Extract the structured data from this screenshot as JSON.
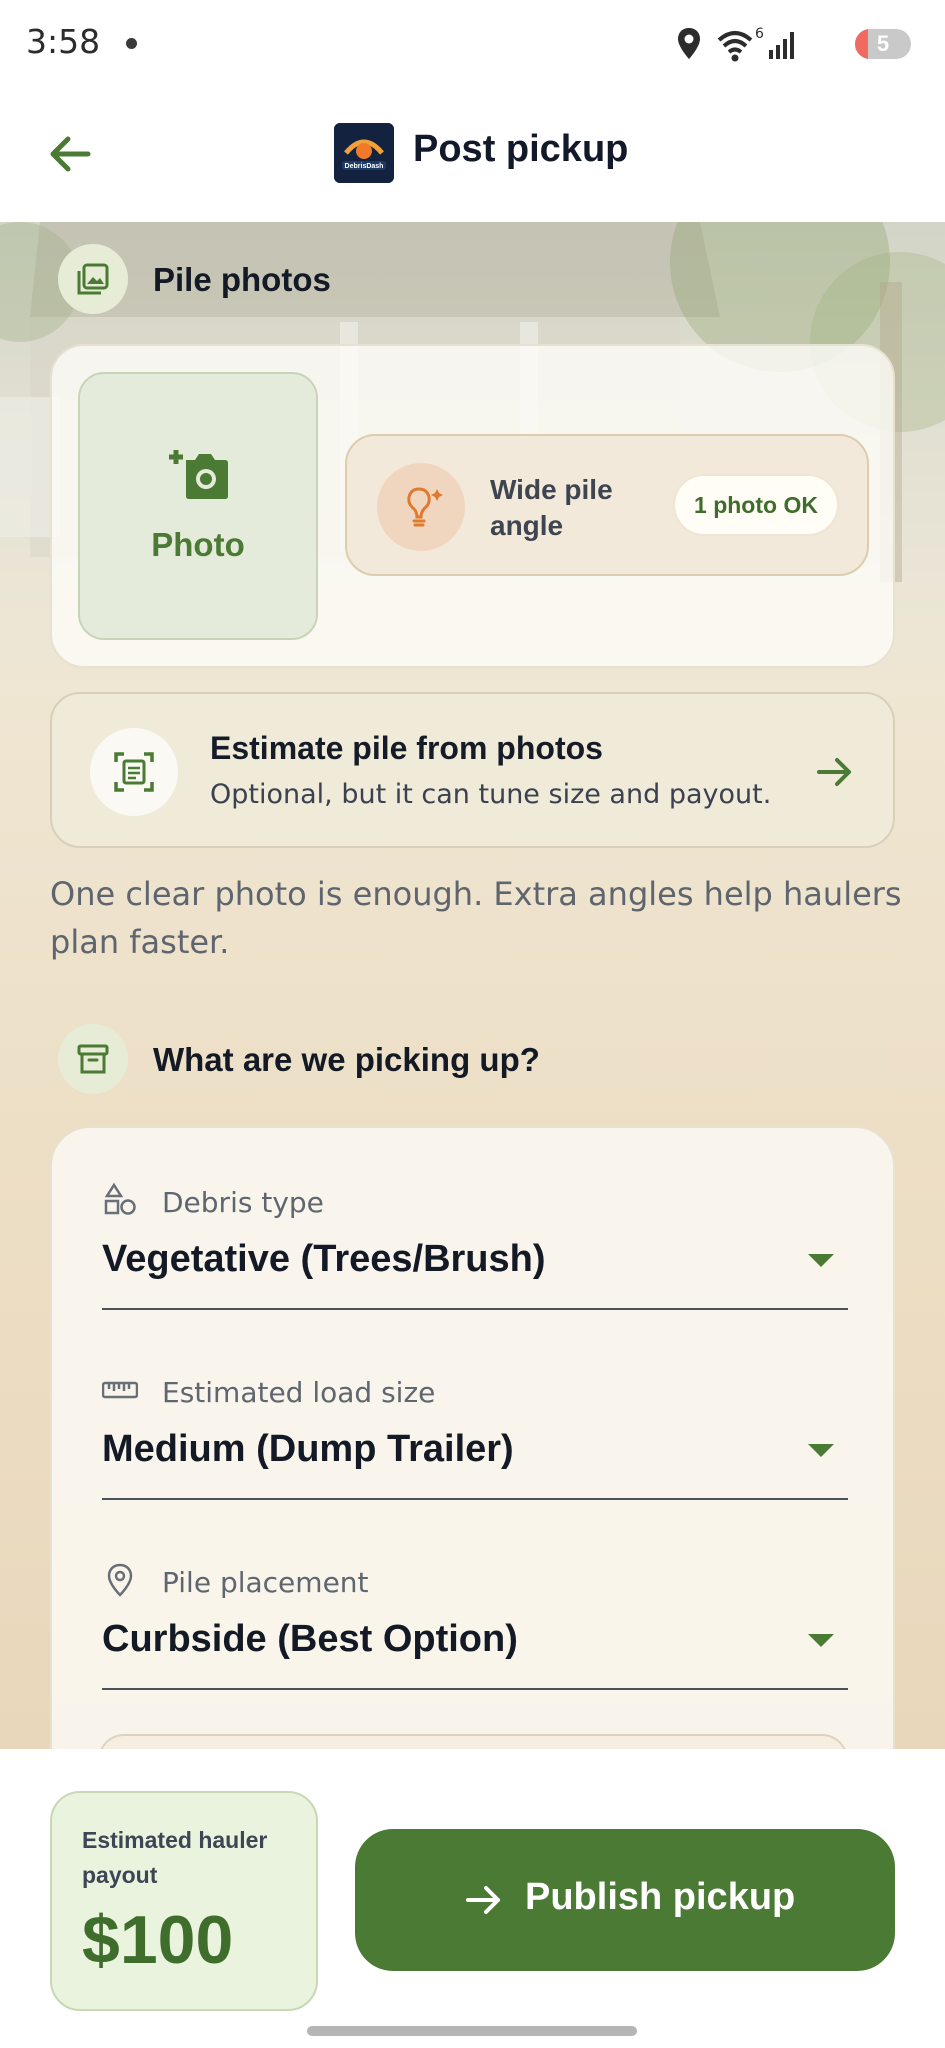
{
  "status_bar": {
    "time": "3:58",
    "battery": "5",
    "icons": [
      "location-icon",
      "wifi-icon",
      "cell-signal-icon",
      "battery-icon"
    ],
    "wifi_badge": "6"
  },
  "app_bar": {
    "title": "Post pickup",
    "logo_text": "DebrisDash"
  },
  "photos_section": {
    "title": "Pile photos",
    "photo_button_label": "Photo",
    "tip_text": "Wide pile angle",
    "tip_badge": "1 photo OK"
  },
  "estimate_card": {
    "title": "Estimate pile from photos",
    "subtitle": "Optional, but it can tune size and payout."
  },
  "helper_text": "One clear photo is enough. Extra angles help haulers plan faster.",
  "details_section": {
    "title": "What are we picking up?",
    "fields": [
      {
        "label": "Debris type",
        "value": "Vegetative (Trees/Brush)",
        "icon": "shapes-icon"
      },
      {
        "label": "Estimated load size",
        "value": "Medium (Dump Trailer)",
        "icon": "ruler-icon"
      },
      {
        "label": "Pile placement",
        "value": "Curbside (Best Option)",
        "icon": "location-pin-icon"
      }
    ]
  },
  "bottom_bar": {
    "payout_label": "Estimated hauler payout",
    "payout_value": "$100",
    "publish_label": "Publish pickup"
  },
  "colors": {
    "accent_green": "#4a7a34",
    "tip_orange": "#e07a2e"
  }
}
